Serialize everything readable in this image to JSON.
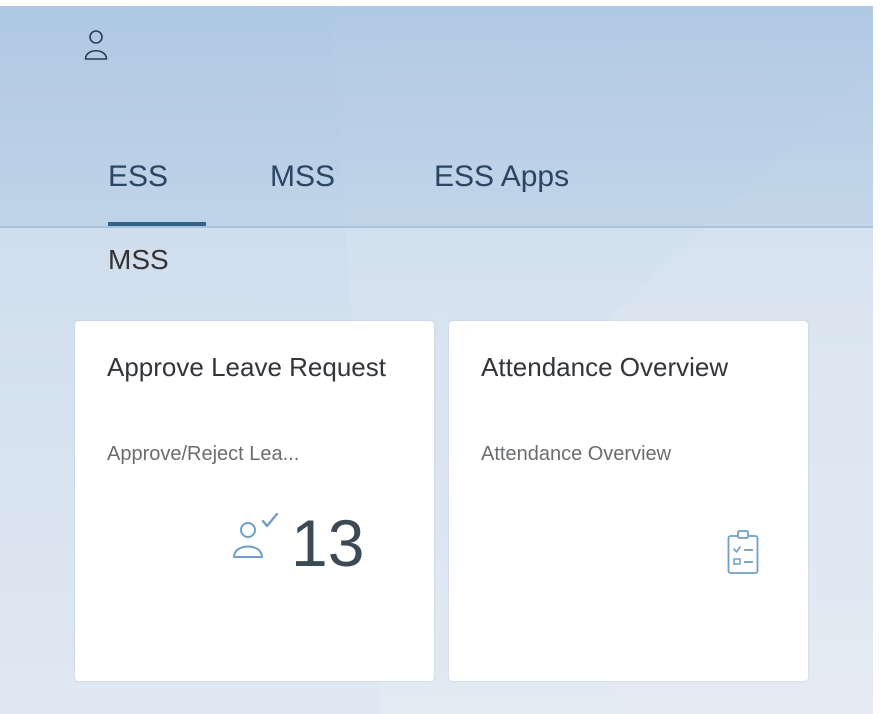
{
  "header": {
    "user_icon": "user-icon"
  },
  "tabs": [
    {
      "label": "ESS",
      "selected": true
    },
    {
      "label": "MSS",
      "selected": false
    },
    {
      "label": "ESS Apps",
      "selected": false
    }
  ],
  "section": {
    "title": "MSS"
  },
  "tiles": [
    {
      "title": "Approve Leave Request",
      "subtitle": "Approve/Reject Lea...",
      "icon": "approvals-icon",
      "kpi": "13"
    },
    {
      "title": "Attendance Overview",
      "subtitle": "Attendance Overview",
      "icon": "checklist-icon"
    }
  ],
  "colors": {
    "accent": "#346187",
    "icon": "#6f9fc9",
    "tab_text": "#2a4664",
    "kpi_text": "#3d4a56"
  }
}
